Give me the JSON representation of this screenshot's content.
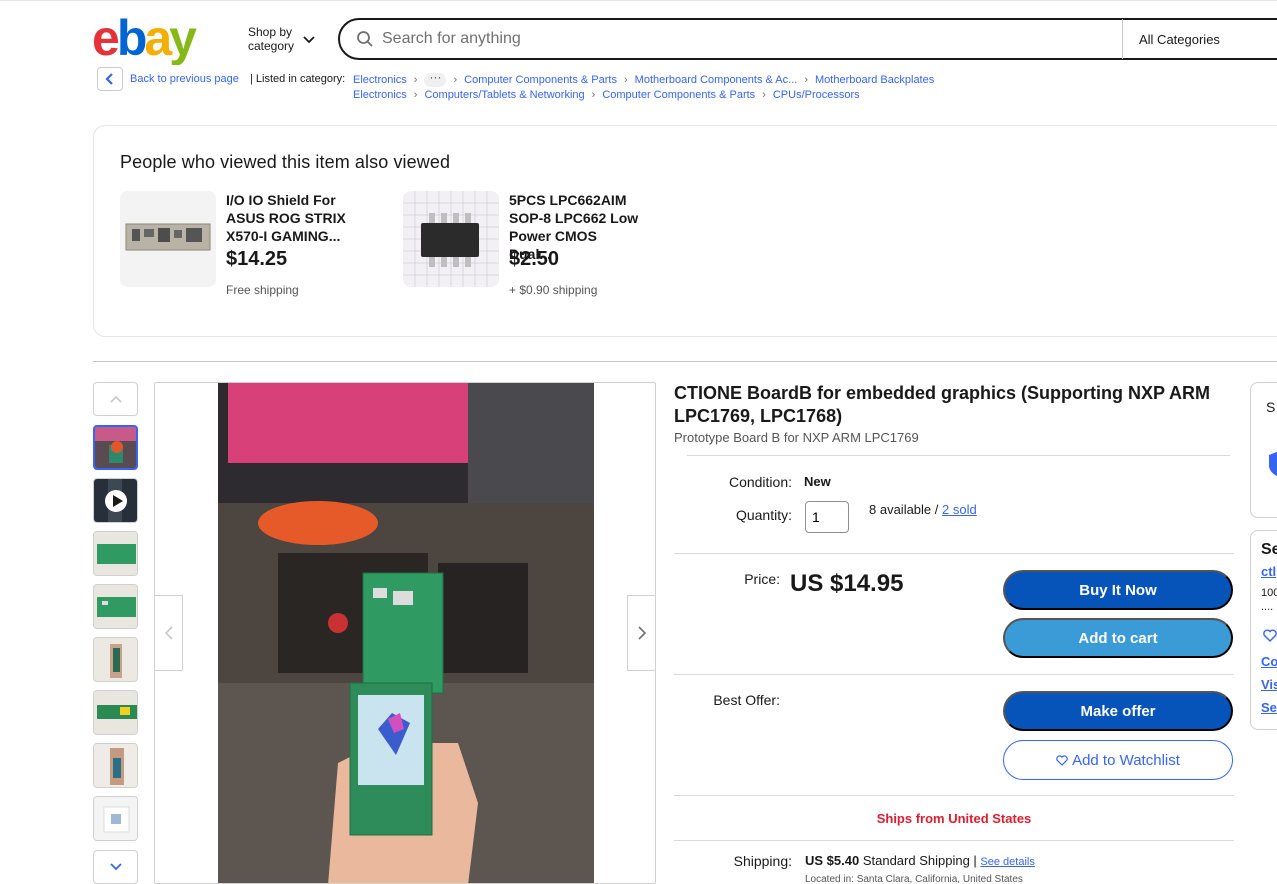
{
  "header": {
    "logo_text": "ebay",
    "shop_by_category": [
      "Shop by",
      "category"
    ],
    "search_placeholder": "Search for anything",
    "category_select": "All Categories"
  },
  "breadcrumb": {
    "back_label": "Back to previous page",
    "listed_in": "| Listed in category:",
    "row1": [
      "Electronics",
      "Computer Components & Parts",
      "Motherboard Components & Ac...",
      "Motherboard Backplates"
    ],
    "row2": [
      "Electronics",
      "Computers/Tablets & Networking",
      "Computer Components & Parts",
      "CPUs/Processors"
    ]
  },
  "also_viewed": {
    "heading": "People who viewed this item also viewed",
    "items": [
      {
        "title": "I/O IO Shield For ASUS ROG STRIX X570-I GAMING...",
        "price": "$14.25",
        "shipping": "Free shipping"
      },
      {
        "title": "5PCS LPC662AIM SOP-8 LPC662 Low Power CMOS Dual...",
        "price": "$2.50",
        "shipping": "+ $0.90 shipping"
      }
    ]
  },
  "item": {
    "title": "CTIONE BoardB for embedded graphics (Supporting NXP ARM LPC1769, LPC1768)",
    "subtitle": "Prototype Board B for NXP ARM LPC1769",
    "condition_label": "Condition:",
    "condition_value": "New",
    "quantity_label": "Quantity:",
    "quantity_value": "1",
    "available": "8 available /",
    "sold": "2 sold",
    "price_label": "Price:",
    "price": "US $14.95",
    "buy_now": "Buy It Now",
    "add_to_cart": "Add to cart",
    "best_offer_label": "Best Offer:",
    "make_offer": "Make offer",
    "add_watchlist": "Add to Watchlist",
    "ships_from": "Ships from United States",
    "shipping_label": "Shipping:",
    "shipping_cost": "US $5.40",
    "shipping_method": "Standard Shipping |",
    "see_details": "See details",
    "located": "Located in: Santa Clara, California, United States"
  },
  "side": {
    "box1_letter": "S",
    "box2_heading": "Se",
    "seller_link": "ctl",
    "feedback": "100",
    "dots": "....",
    "links": [
      "Co",
      "Vis",
      "Se"
    ]
  },
  "colors": {
    "accent": "#3665f3",
    "ships": "#dd1e31"
  }
}
